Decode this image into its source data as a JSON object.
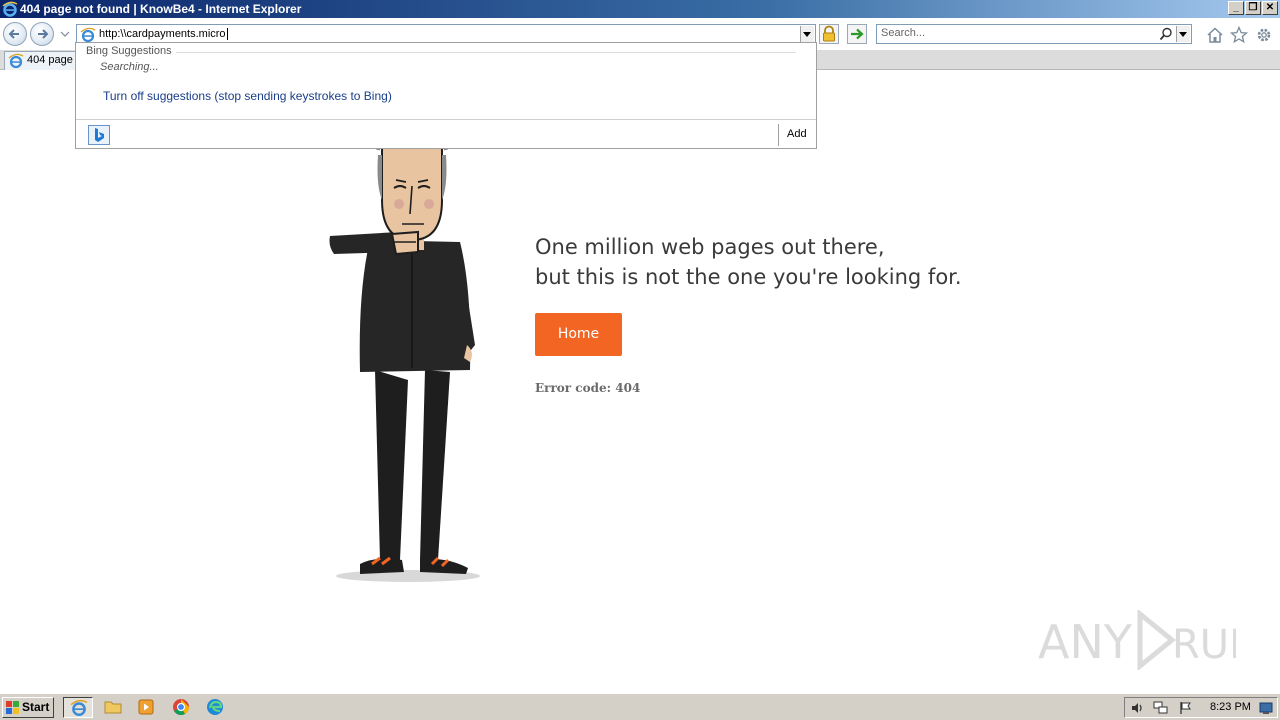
{
  "window": {
    "title": "404 page not found | KnowBe4 - Internet Explorer",
    "minimize": "_",
    "restore": "❐",
    "close": "✕"
  },
  "address_bar": {
    "url": "http:\\\\cardpayments.micro"
  },
  "search_bar": {
    "placeholder": "Search..."
  },
  "tab": {
    "label": "404 page"
  },
  "suggestions": {
    "heading": "Bing Suggestions",
    "status": "Searching...",
    "turn_off": "Turn off suggestions (stop sending keystrokes to Bing)",
    "add": "Add"
  },
  "page": {
    "message_line1": "One million web pages out there,",
    "message_line2": "but this is not the one you're looking for.",
    "home_button": "Home",
    "error_code": "Error code: 404"
  },
  "taskbar": {
    "start": "Start",
    "clock": "8:23 PM"
  },
  "colors": {
    "accent": "#f26522",
    "text": "#3a3a3a",
    "link": "#1a3e8c"
  }
}
